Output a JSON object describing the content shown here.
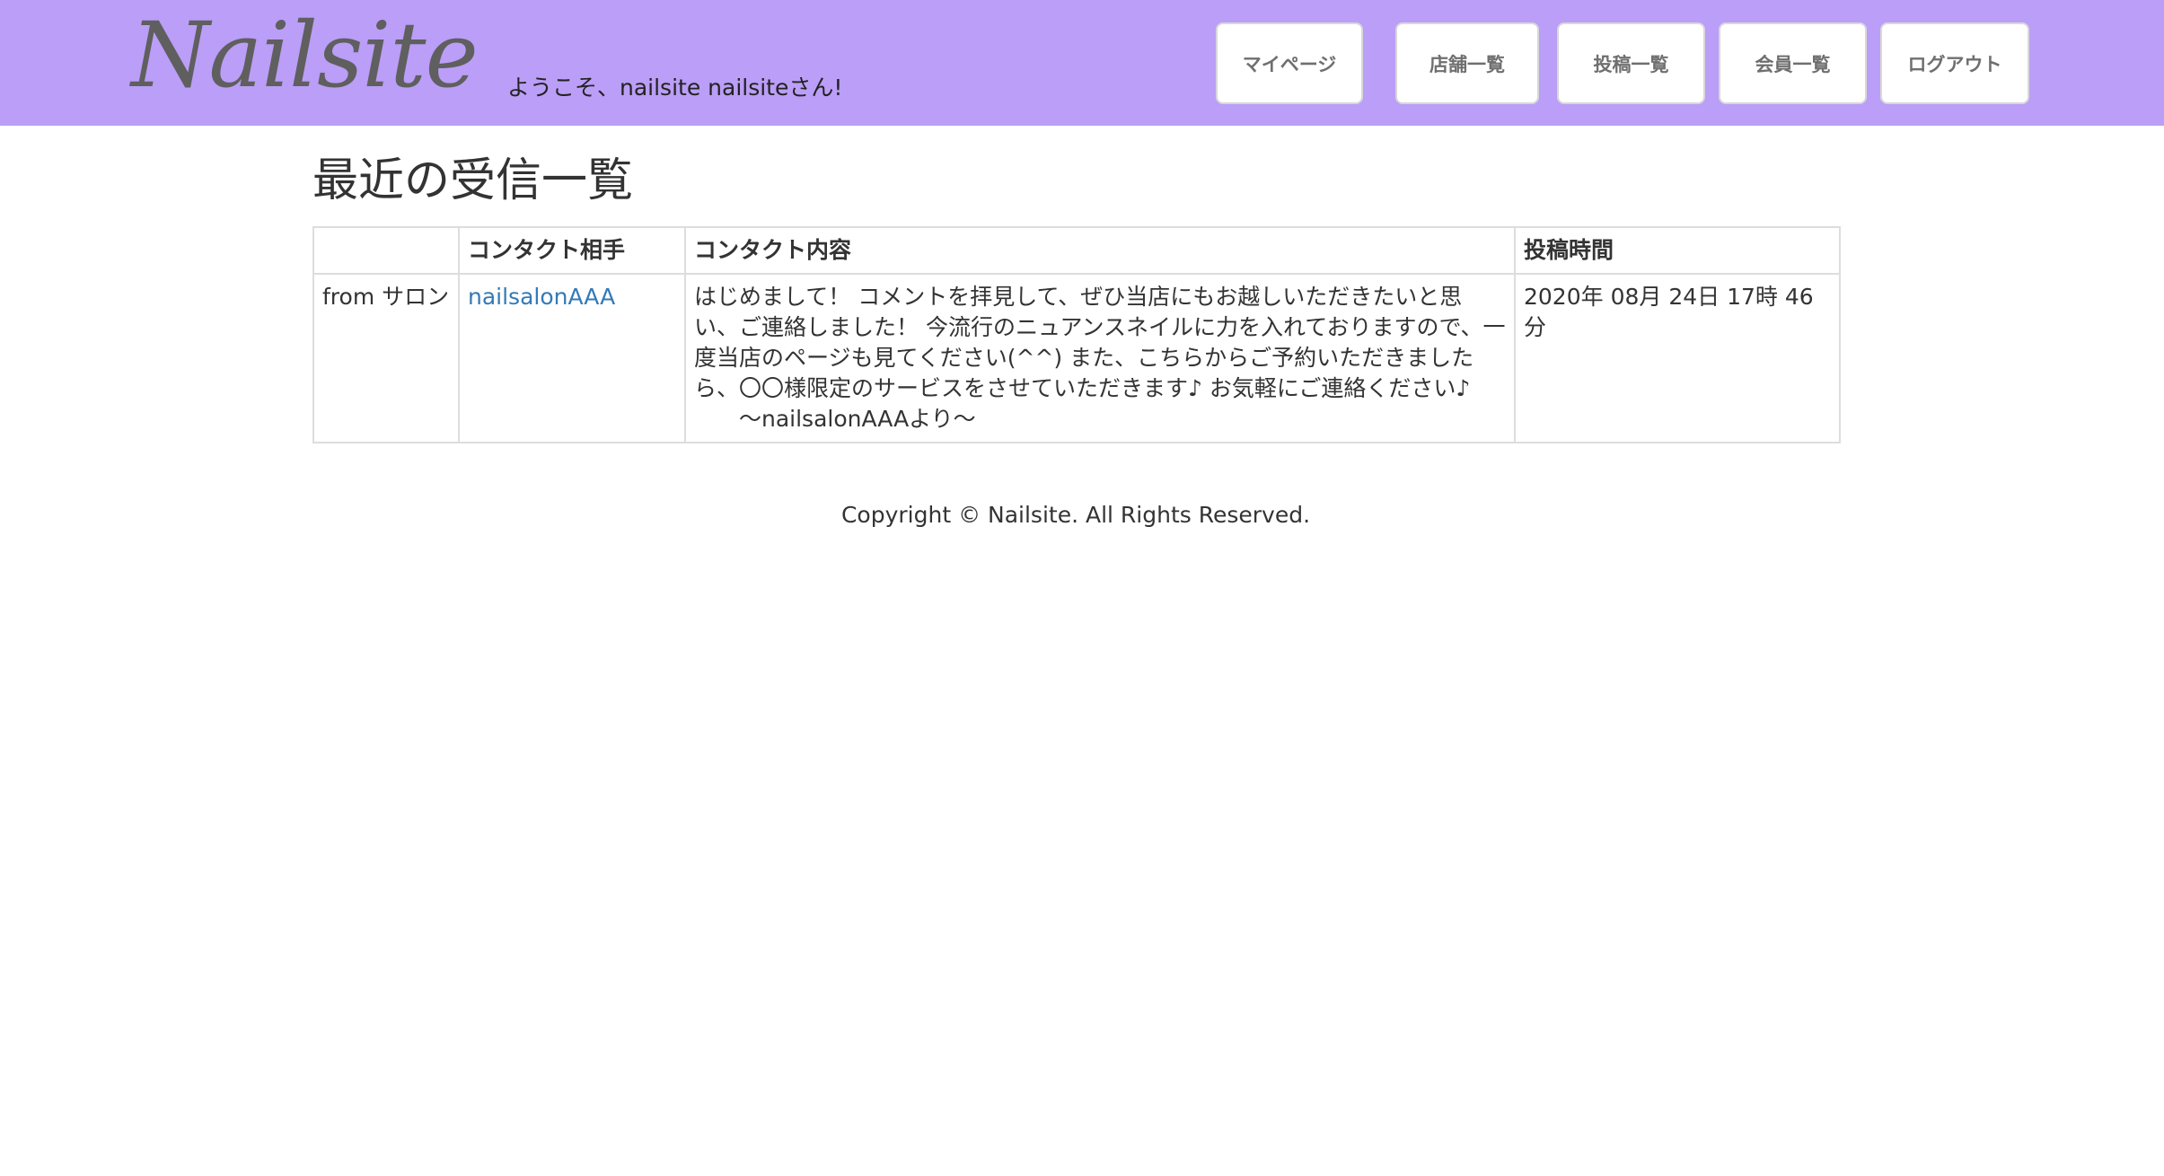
{
  "header": {
    "logo": "Nailsite",
    "welcome": "ようこそ、nailsite nailsiteさん!",
    "nav": {
      "mypage": "マイページ",
      "shops": "店舗一覧",
      "posts": "投稿一覧",
      "members": "会員一覧",
      "logout": "ログアウト"
    },
    "colors": {
      "background": "#bb9ef7",
      "button_text": "#6f6f6f"
    }
  },
  "main": {
    "title": "最近の受信一覧",
    "table": {
      "headers": [
        "",
        "コンタクト相手",
        "コンタクト内容",
        "投稿時間"
      ],
      "rows": [
        {
          "from": "from サロン",
          "partner": "nailsalonAAA",
          "content": "はじめまして！ コメントを拝見して、ぜひ当店にもお越しいただきたいと思い、ご連絡しました！ 今流行のニュアンスネイルに力を入れておりますので、一度当店のページも見てください(^^) また、こちらからご予約いただきましたら、〇〇様限定のサービスをさせていただきます♪ お気軽にご連絡ください♪ 　　〜nailsalonAAAより〜",
          "time": "2020年 08月 24日 17時 46分"
        }
      ]
    },
    "link_color": "#337ab7"
  },
  "footer": {
    "copyright": "Copyright © Nailsite. All Rights Reserved."
  }
}
